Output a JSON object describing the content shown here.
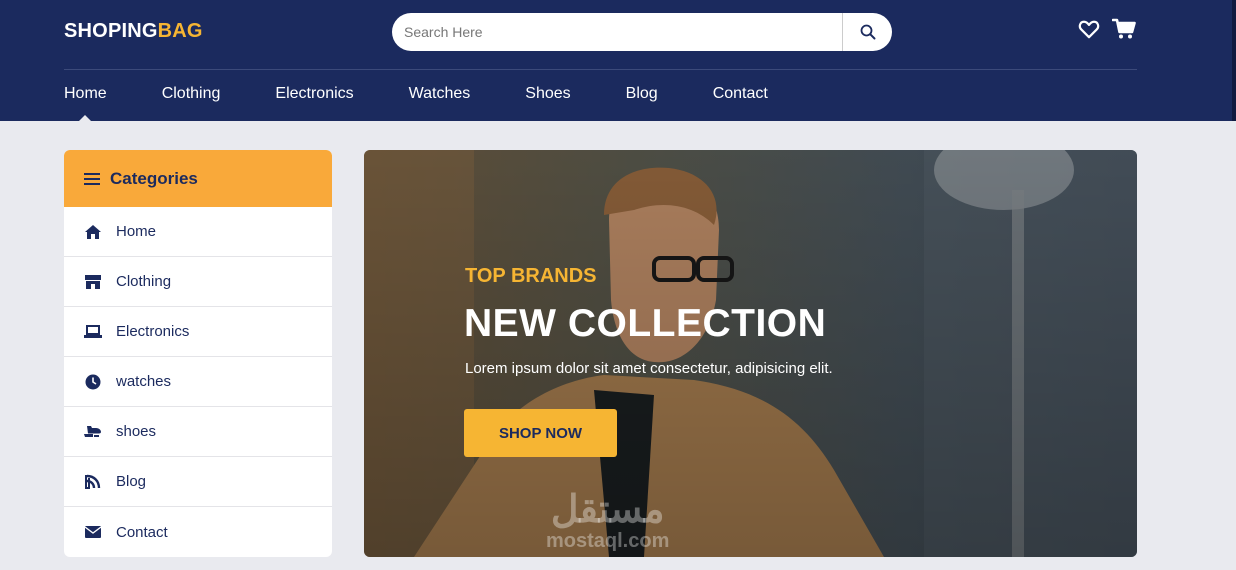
{
  "brand": {
    "part1": "SHOPING",
    "part2": "BAG"
  },
  "search": {
    "placeholder": "Search Here"
  },
  "nav": [
    "Home",
    "Clothing",
    "Electronics",
    "Watches",
    "Shoes",
    "Blog",
    "Contact"
  ],
  "categories": {
    "title": "Categories",
    "items": [
      {
        "label": "Home",
        "icon": "home-icon"
      },
      {
        "label": "Clothing",
        "icon": "store-icon"
      },
      {
        "label": "Electronics",
        "icon": "laptop-icon"
      },
      {
        "label": "watches",
        "icon": "clock-icon"
      },
      {
        "label": "shoes",
        "icon": "shoe-icon"
      },
      {
        "label": "Blog",
        "icon": "feed-icon"
      },
      {
        "label": "Contact",
        "icon": "envelope-icon"
      }
    ]
  },
  "hero": {
    "subtitle": "TOP BRANDS",
    "title": "NEW COLLECTION",
    "description": "Lorem ipsum dolor sit amet consectetur, adipisicing elit.",
    "button": "SHOP NOW"
  },
  "watermark": {
    "arabic": "مستقل",
    "latin": "mostaql.com"
  },
  "colors": {
    "navy": "#1b2a5e",
    "accent": "#f6b533",
    "orange": "#f9a93a",
    "background": "#e9eaef"
  }
}
